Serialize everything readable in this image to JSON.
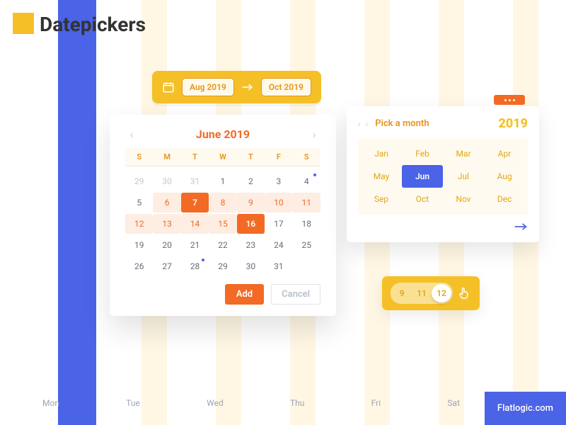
{
  "title": "Datepickers",
  "range": {
    "from": "Aug 2019",
    "to": "Oct 2019"
  },
  "calendar": {
    "title": "June 2019",
    "dows": [
      "S",
      "M",
      "T",
      "W",
      "T",
      "F",
      "S"
    ],
    "cells": [
      {
        "n": "29",
        "out": true
      },
      {
        "n": "30",
        "out": true
      },
      {
        "n": "31",
        "out": true
      },
      {
        "n": "1"
      },
      {
        "n": "2"
      },
      {
        "n": "3"
      },
      {
        "n": "4",
        "dot": true
      },
      {
        "n": "5"
      },
      {
        "n": "6",
        "hl": true
      },
      {
        "n": "7",
        "sel": true
      },
      {
        "n": "8",
        "hl": true
      },
      {
        "n": "9",
        "hl": true
      },
      {
        "n": "10",
        "hl": true
      },
      {
        "n": "11",
        "hl": true
      },
      {
        "n": "12",
        "hl": true
      },
      {
        "n": "13",
        "hl": true
      },
      {
        "n": "14",
        "hl": true
      },
      {
        "n": "15",
        "hl": true
      },
      {
        "n": "16",
        "sel": true
      },
      {
        "n": "17"
      },
      {
        "n": "18"
      },
      {
        "n": "19"
      },
      {
        "n": "20"
      },
      {
        "n": "21"
      },
      {
        "n": "22"
      },
      {
        "n": "23"
      },
      {
        "n": "24"
      },
      {
        "n": "25"
      },
      {
        "n": "26"
      },
      {
        "n": "27"
      },
      {
        "n": "28",
        "dot": true
      },
      {
        "n": "29"
      },
      {
        "n": "30"
      },
      {
        "n": "31"
      },
      {
        "n": "",
        "out": true
      }
    ],
    "add": "Add",
    "cancel": "Cancel"
  },
  "monthPicker": {
    "label": "Pick a month",
    "year": "2019",
    "months": [
      "Jan",
      "Feb",
      "Mar",
      "Apr",
      "May",
      "Jun",
      "Jul",
      "Aug",
      "Sep",
      "Oct",
      "Nov",
      "Dec"
    ],
    "selectedIndex": 5
  },
  "timeToggle": {
    "values": [
      "9",
      "11",
      "12"
    ],
    "knobIndex": 2
  },
  "footerDays": [
    "Mon",
    "Tue",
    "Wed",
    "Thu",
    "Fri",
    "Sat"
  ],
  "brand": "Flatlogic.com",
  "colors": {
    "blue": "#4a63e7",
    "yellow": "#f5c027",
    "orange": "#f36a25",
    "cream": "#fff7e4"
  }
}
